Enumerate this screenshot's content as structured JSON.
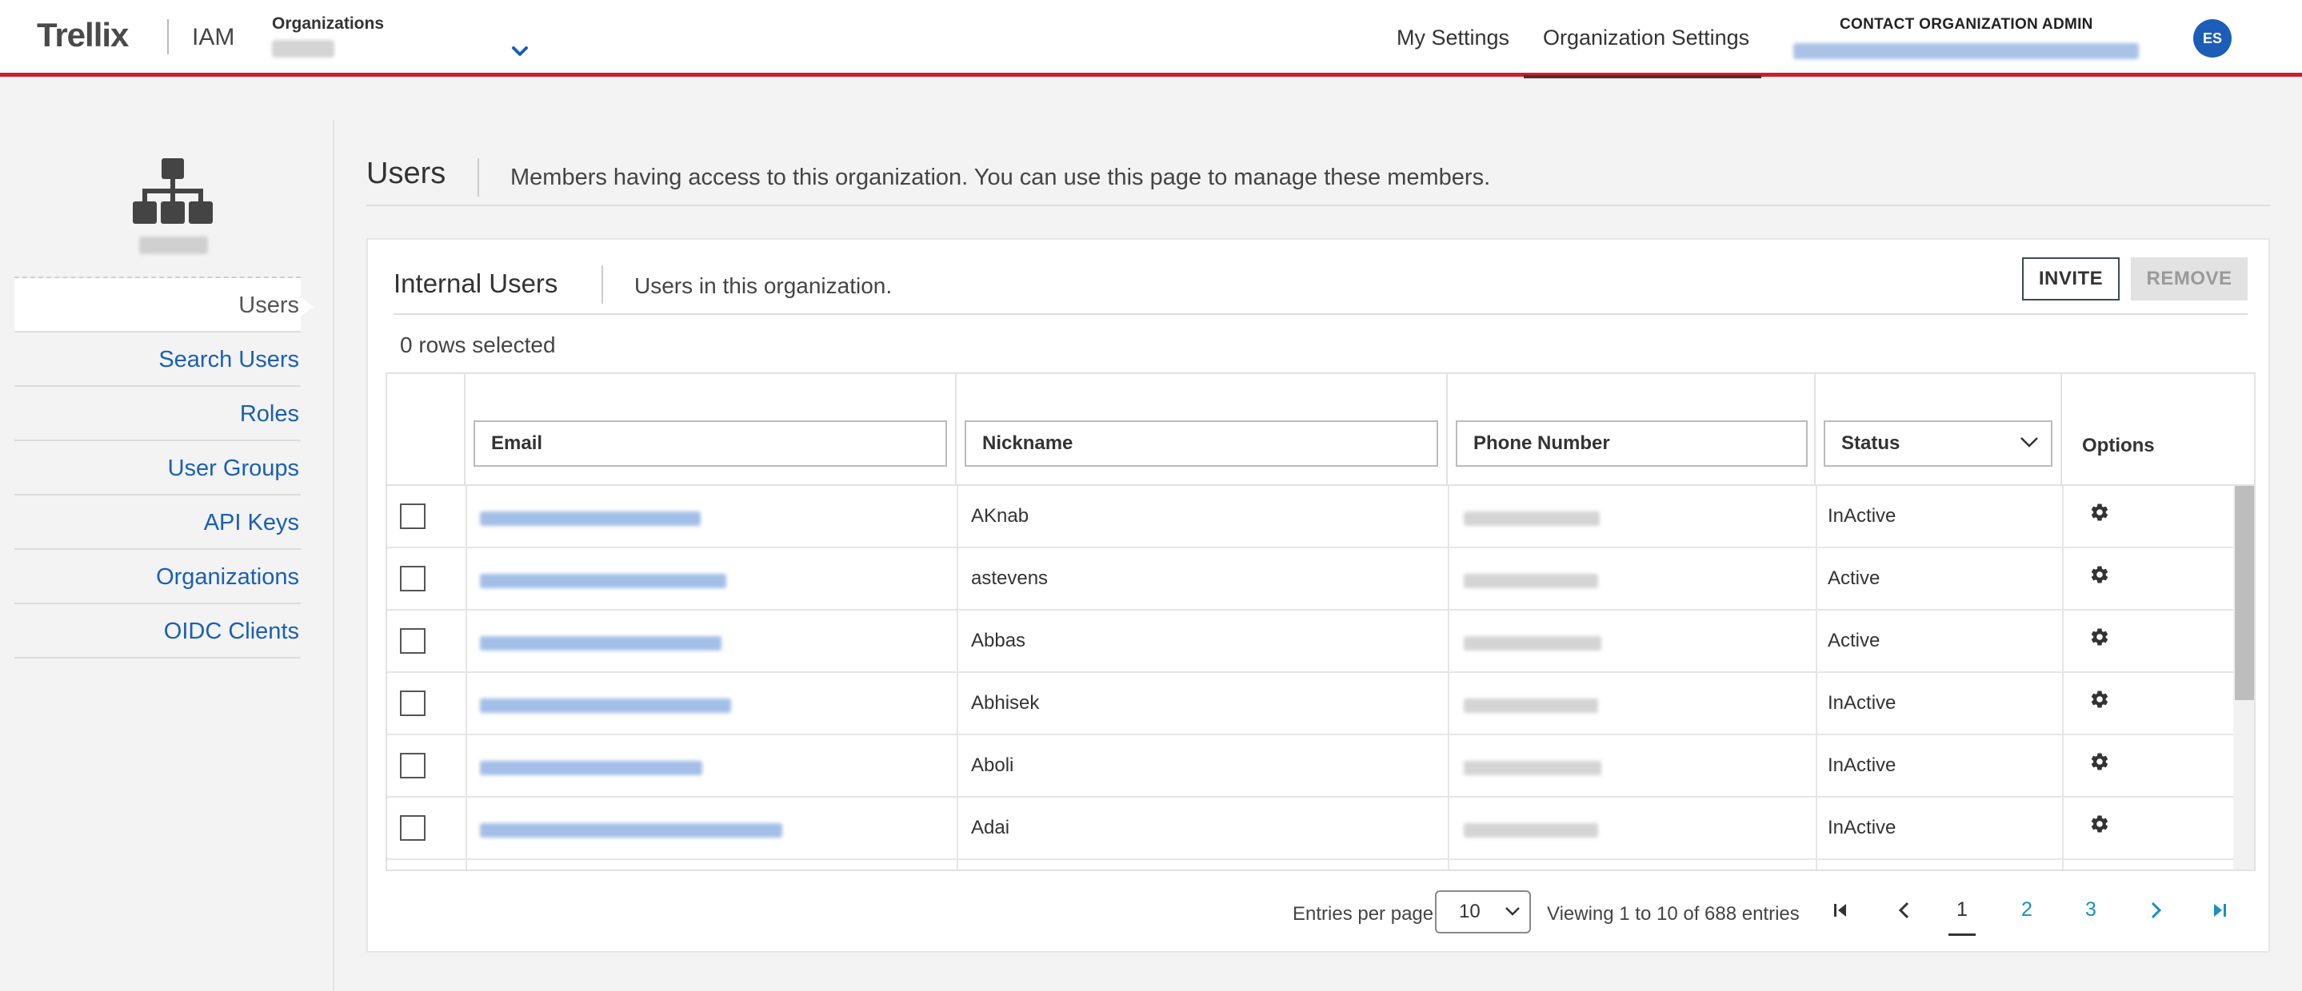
{
  "header": {
    "logo": "Trellix",
    "app_name": "IAM",
    "org_label": "Organizations",
    "nav": {
      "my_settings": "My Settings",
      "org_settings": "Organization Settings"
    },
    "contact_title": "CONTACT ORGANIZATION ADMIN",
    "avatar_initials": "ES",
    "accent_color": "#c8202f",
    "avatar_color": "#1c5db8"
  },
  "sidebar": {
    "icon": "org-hierarchy-icon",
    "items": [
      {
        "label": "Users",
        "active": true
      },
      {
        "label": "Search Users"
      },
      {
        "label": "Roles"
      },
      {
        "label": "User Groups"
      },
      {
        "label": "API Keys"
      },
      {
        "label": "Organizations"
      },
      {
        "label": "OIDC Clients"
      }
    ]
  },
  "main": {
    "title": "Users",
    "description": "Members having access to this organization. You can use this page to manage these members."
  },
  "card": {
    "title": "Internal Users",
    "description": "Users in this organization.",
    "invite_label": "INVITE",
    "remove_label": "REMOVE",
    "rows_selected": "0 rows selected"
  },
  "table": {
    "columns": {
      "email": "Email",
      "nickname": "Nickname",
      "phone": "Phone Number",
      "status": "Status",
      "options": "Options"
    },
    "rows": [
      {
        "nickname": "AKnab",
        "status": "InActive"
      },
      {
        "nickname": "astevens",
        "status": "Active"
      },
      {
        "nickname": "Abbas",
        "status": "Active"
      },
      {
        "nickname": "Abhisek",
        "status": "InActive"
      },
      {
        "nickname": "Aboli",
        "status": "InActive"
      },
      {
        "nickname": "Adai",
        "status": "InActive"
      }
    ]
  },
  "pagination": {
    "entries_label": "Entries per page",
    "entries_value": "10",
    "viewing": "Viewing 1 to 10 of 688 entries",
    "pages": [
      "1",
      "2",
      "3"
    ],
    "current_page": "1"
  }
}
